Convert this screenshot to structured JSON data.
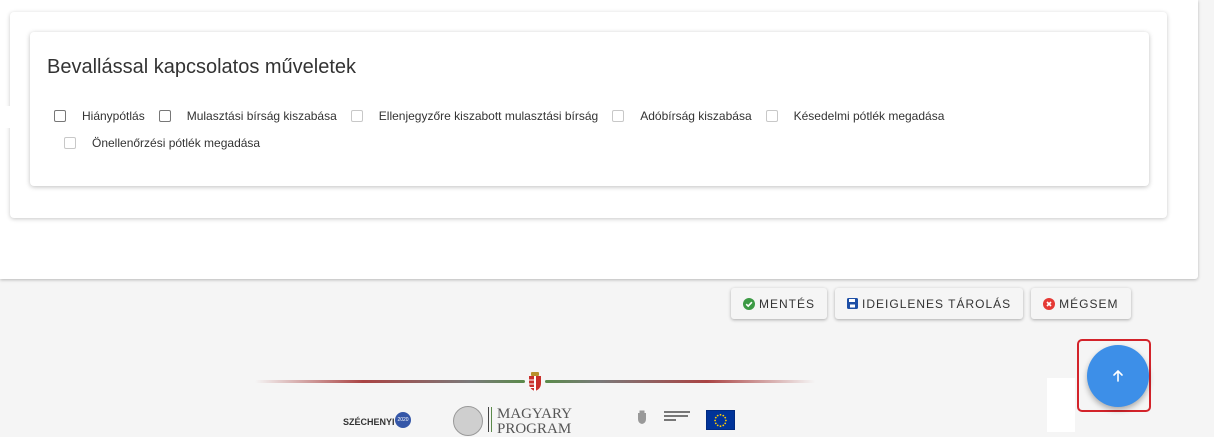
{
  "card": {
    "title": "Bevallással kapcsolatos műveletek",
    "checkboxes_row1": [
      "Hiánypótlás",
      "Mulasztási bírság kiszabása",
      "Ellenjegyzőre kiszabott mulasztási bírság",
      "Adóbírság kiszabása",
      "Késedelmi pótlék megadása"
    ],
    "checkboxes_row2": [
      "Önellenőrzési pótlék megadása"
    ]
  },
  "actions": {
    "save_label": "MENTÉS",
    "temp_save_label": "IDEIGLENES TÁROLÁS",
    "cancel_label": "MÉGSEM"
  },
  "footer": {
    "szechenyi": "SZÉCHENYI",
    "szechenyi_badge": "2020",
    "magyary_line1": "MAGYARY",
    "magyary_line2": "PROGRAM"
  },
  "colors": {
    "fab": "#3d8fe8",
    "save_icon": "#3c9a45",
    "temp_icon": "#1e4fa6",
    "cancel_icon": "#e53935",
    "highlight": "#d3232a"
  },
  "icons": {
    "fab": "arrow-up-icon",
    "save": "check-circle-icon",
    "temp": "floppy-disk-icon",
    "cancel": "x-circle-icon"
  }
}
